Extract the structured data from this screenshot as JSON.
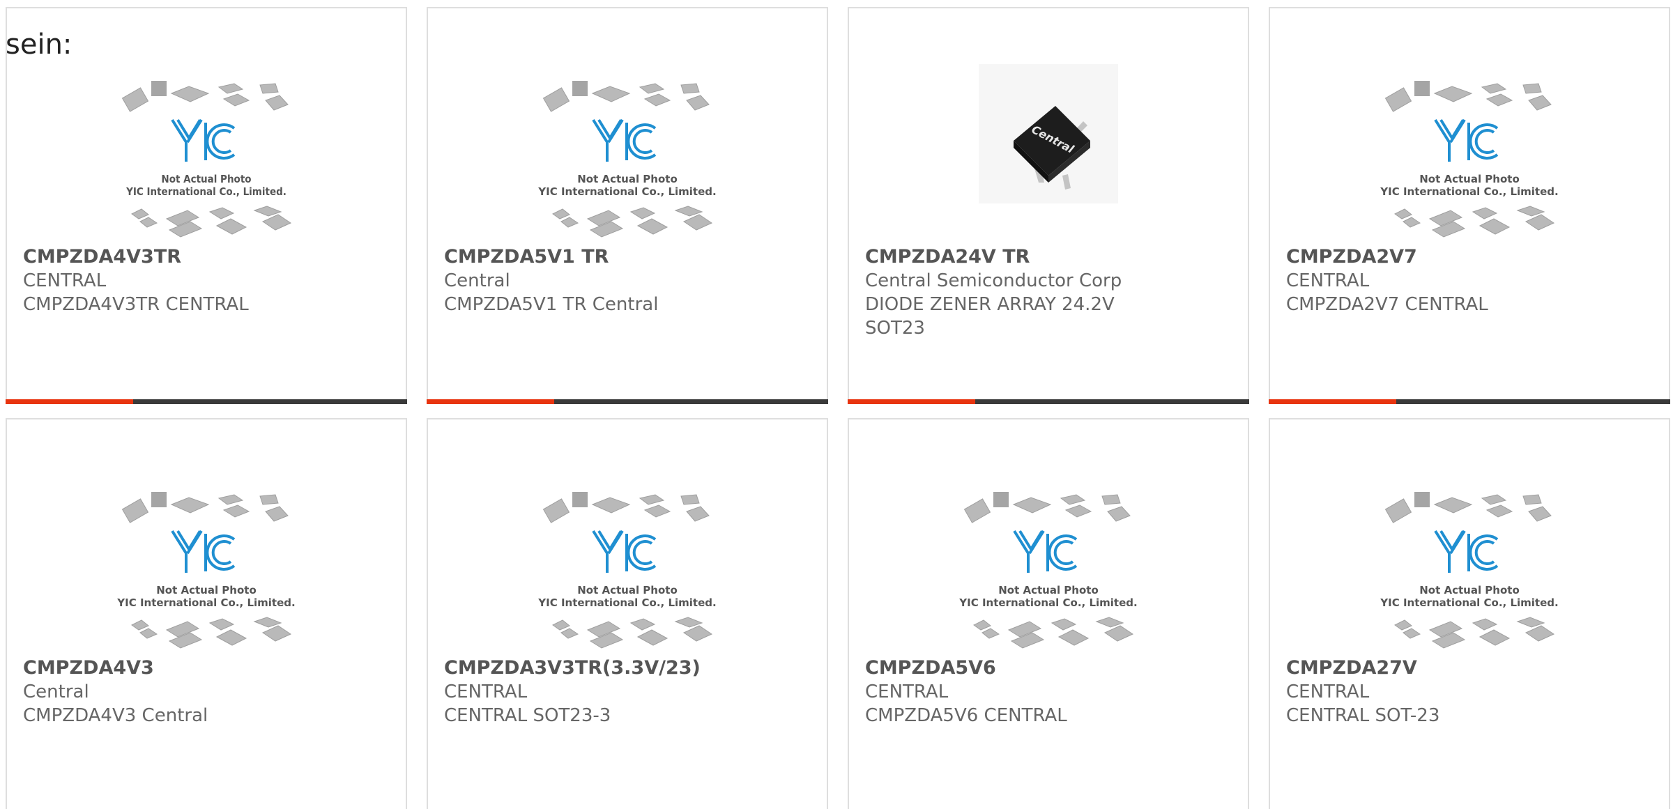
{
  "page": {
    "heading_fragment": "sein:"
  },
  "placeholder": {
    "logo": "YIC",
    "line1": "Not Actual Photo",
    "line2": "YIC International Co., Limited."
  },
  "products": [
    {
      "part_number": "CMPZDA4V3TR",
      "manufacturer": "CENTRAL",
      "description": "CMPZDA4V3TR CENTRAL",
      "image": "placeholder"
    },
    {
      "part_number": "CMPZDA5V1 TR",
      "manufacturer": "Central",
      "description": "CMPZDA5V1 TR Central",
      "image": "placeholder"
    },
    {
      "part_number": "CMPZDA24V TR",
      "manufacturer": "Central Semiconductor Corp",
      "description": "DIODE ZENER ARRAY 24.2V SOT23",
      "image": "photo",
      "chip_marking": "Central"
    },
    {
      "part_number": "CMPZDA2V7",
      "manufacturer": "CENTRAL",
      "description": "CMPZDA2V7 CENTRAL",
      "image": "placeholder"
    },
    {
      "part_number": "CMPZDA4V3",
      "manufacturer": "Central",
      "description": "CMPZDA4V3 Central",
      "image": "placeholder"
    },
    {
      "part_number": "CMPZDA3V3TR(3.3V/23)",
      "manufacturer": "CENTRAL",
      "description": "CENTRAL SOT23-3",
      "image": "placeholder"
    },
    {
      "part_number": "CMPZDA5V6",
      "manufacturer": "CENTRAL",
      "description": "CMPZDA5V6 CENTRAL",
      "image": "placeholder"
    },
    {
      "part_number": "CMPZDA27V",
      "manufacturer": "CENTRAL",
      "description": "CENTRAL SOT-23",
      "image": "placeholder"
    }
  ],
  "colors": {
    "accent": "#e8340f",
    "bar": "#3a3a3a",
    "logo_blue": "#1f8fd1",
    "text": "#666666"
  }
}
